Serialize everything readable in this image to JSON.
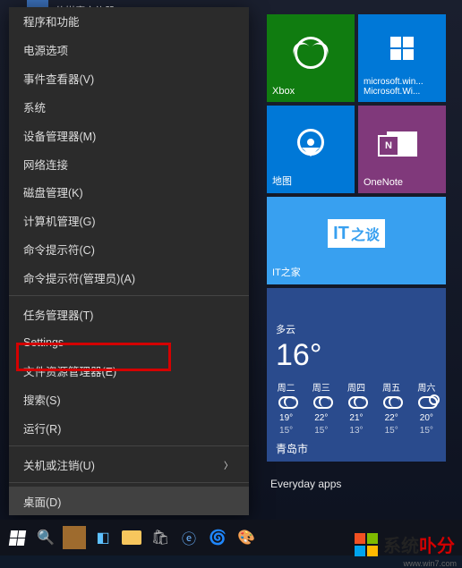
{
  "desktop": {
    "shortcut_label": "软媒魔方礼器"
  },
  "context_menu": {
    "items": [
      {
        "label": "程序和功能"
      },
      {
        "label": "电源选项"
      },
      {
        "label": "事件查看器(V)"
      },
      {
        "label": "系统"
      },
      {
        "label": "设备管理器(M)"
      },
      {
        "label": "网络连接"
      },
      {
        "label": "磁盘管理(K)"
      },
      {
        "label": "计算机管理(G)"
      },
      {
        "label": "命令提示符(C)"
      },
      {
        "label": "命令提示符(管理员)(A)"
      },
      {
        "label": "任务管理器(T)"
      },
      {
        "label": "Settings"
      },
      {
        "label": "文件资源管理器(E)"
      },
      {
        "label": "搜索(S)"
      },
      {
        "label": "运行(R)"
      },
      {
        "label": "关机或注销(U)",
        "submenu": true
      },
      {
        "label": "桌面(D)"
      }
    ]
  },
  "tiles": {
    "xbox": {
      "label": "Xbox"
    },
    "mswin": {
      "line1": "microsoft.win...",
      "line2": "Microsoft.Wi..."
    },
    "map": {
      "label": "地图"
    },
    "onenote": {
      "label": "OneNote"
    },
    "ithome": {
      "label": "IT之家",
      "logo1": "IT",
      "logo2": "之谈"
    },
    "weather": {
      "cond": "多云",
      "temp": "16°",
      "days": [
        {
          "d": "周二",
          "hi": "19°",
          "lo": "15°",
          "sun": false
        },
        {
          "d": "周三",
          "hi": "22°",
          "lo": "15°",
          "sun": false
        },
        {
          "d": "周四",
          "hi": "21°",
          "lo": "13°",
          "sun": false
        },
        {
          "d": "周五",
          "hi": "22°",
          "lo": "15°",
          "sun": false
        },
        {
          "d": "周六",
          "hi": "20°",
          "lo": "15°",
          "sun": true
        }
      ],
      "loc": "青岛市"
    },
    "everyday": {
      "label": "Everyday apps"
    }
  },
  "watermark": {
    "text1": "系统",
    "text2": "卟分",
    "url": "www.win7.com"
  }
}
